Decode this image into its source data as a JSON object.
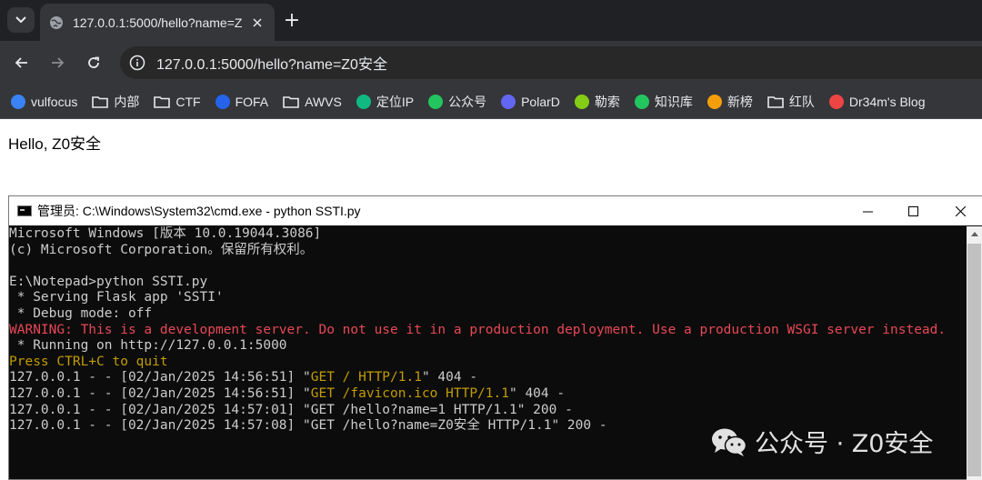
{
  "browser": {
    "tab_title": "127.0.0.1:5000/hello?name=Z",
    "new_tab_label": "+",
    "url": "127.0.0.1:5000/hello?name=Z0安全",
    "bookmarks": [
      {
        "label": "vulfocus",
        "icon": "shield-icon",
        "color": "#3b82f6"
      },
      {
        "label": "内部",
        "icon": "folder-icon"
      },
      {
        "label": "CTF",
        "icon": "folder-icon"
      },
      {
        "label": "FOFA",
        "icon": "fofa-icon",
        "color": "#2563eb"
      },
      {
        "label": "AWVS",
        "icon": "folder-icon"
      },
      {
        "label": "定位IP",
        "icon": "ip-icon",
        "color": "#10b981"
      },
      {
        "label": "公众号",
        "icon": "wechat-icon",
        "color": "#22c55e"
      },
      {
        "label": "PolarD",
        "icon": "polar-icon",
        "color": "#6366f1"
      },
      {
        "label": "勒索",
        "icon": "plus-circle-icon",
        "color": "#84cc16"
      },
      {
        "label": "知识库",
        "icon": "knowledge-icon",
        "color": "#22c55e"
      },
      {
        "label": "新榜",
        "icon": "xinbang-icon",
        "color": "#f59e0b"
      },
      {
        "label": "红队",
        "icon": "folder-icon"
      },
      {
        "label": "Dr34m's Blog",
        "icon": "blog-icon",
        "color": "#ef4444"
      }
    ]
  },
  "page": {
    "greeting": "Hello, Z0安全"
  },
  "cmd": {
    "title": "管理员: C:\\Windows\\System32\\cmd.exe - python  SSTI.py",
    "lines": [
      {
        "text": "Microsoft Windows [版本 10.0.19044.3086]",
        "color": "default"
      },
      {
        "text": "(c) Microsoft Corporation。保留所有权利。",
        "color": "default"
      },
      {
        "text": "",
        "color": "default"
      },
      {
        "text": "E:\\Notepad>python SSTI.py",
        "color": "default"
      },
      {
        "text": " * Serving Flask app 'SSTI'",
        "color": "default"
      },
      {
        "text": " * Debug mode: off",
        "color": "default"
      },
      {
        "text": "WARNING: This is a development server. Do not use it in a production deployment. Use a production WSGI server instead.",
        "color": "red"
      },
      {
        "text": " * Running on http://127.0.0.1:5000",
        "color": "default"
      },
      {
        "text": "Press CTRL+C to quit",
        "color": "yellow"
      }
    ],
    "log_lines": [
      {
        "prefix": "127.0.0.1 - - [02/Jan/2025 14:56:51] \"",
        "request": "GET / HTTP/1.1",
        "suffix": "\" 404 -",
        "color": "yellow"
      },
      {
        "prefix": "127.0.0.1 - - [02/Jan/2025 14:56:51] \"",
        "request": "GET /favicon.ico HTTP/1.1",
        "suffix": "\" 404 -",
        "color": "yellow"
      },
      {
        "prefix": "127.0.0.1 - - [02/Jan/2025 14:57:01] \"",
        "request": "GET /hello?name=1 HTTP/1.1",
        "suffix": "\" 200 -",
        "color": "default"
      },
      {
        "prefix": "127.0.0.1 - - [02/Jan/2025 14:57:08] \"",
        "request": "GET /hello?name=Z0安全 HTTP/1.1",
        "suffix": "\" 200 -",
        "color": "default"
      }
    ]
  },
  "watermark": {
    "text": "公众号 · Z0安全"
  }
}
